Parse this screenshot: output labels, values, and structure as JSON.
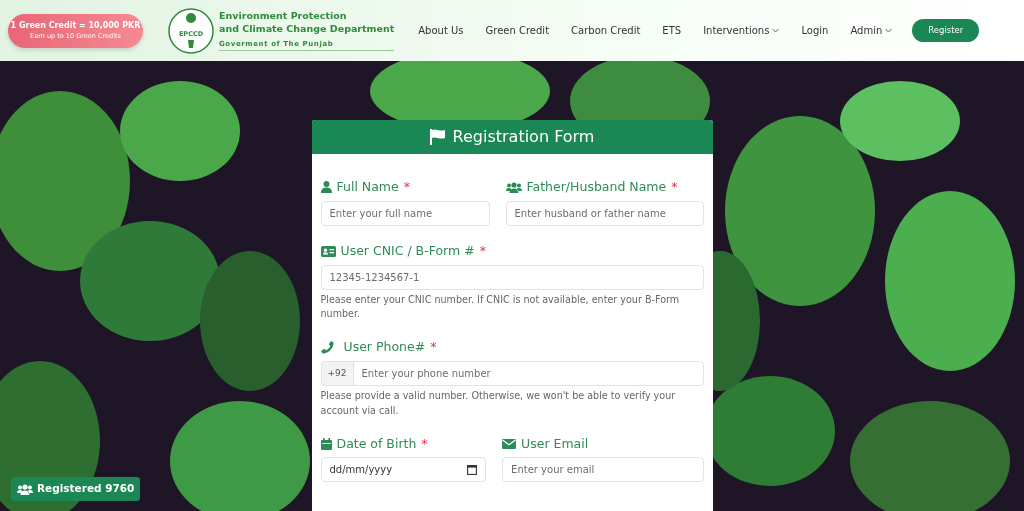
{
  "promo": {
    "title": "1 Green Credit = 10,000 PKR",
    "subtitle": "Earn up to 10 Green Credits"
  },
  "brand": {
    "logo_text": "EPCCD",
    "name_lines": [
      "Environment Protection",
      "and Climate Change Department"
    ],
    "subtitle": "Goverment of The Punjab"
  },
  "nav": {
    "items": [
      {
        "label": "About Us",
        "dropdown": false
      },
      {
        "label": "Green Credit",
        "dropdown": false
      },
      {
        "label": "Carbon Credit",
        "dropdown": false
      },
      {
        "label": "ETS",
        "dropdown": false
      },
      {
        "label": "Interventions",
        "dropdown": true
      },
      {
        "label": "Login",
        "dropdown": false
      },
      {
        "label": "Admin",
        "dropdown": true
      }
    ],
    "button": "Register"
  },
  "form": {
    "title": "Registration Form",
    "rows": [
      [
        {
          "kind": "text",
          "label": "Full Name",
          "required_mark": "*",
          "placeholder": "Enter your full name"
        },
        {
          "kind": "text",
          "label": "Father/Husband Name",
          "required_mark": "*",
          "placeholder": "Enter husband or father name"
        }
      ],
      [
        {
          "kind": "text",
          "label": "User CNIC / B-Form #",
          "required_mark": "*",
          "placeholder": "12345-1234567-1",
          "help": "Please enter your CNIC number. If CNIC is not available, enter your B-Form number."
        }
      ],
      [
        {
          "kind": "phone",
          "label": "User Phone#",
          "required_mark": "*",
          "prefix": "+92",
          "placeholder": "Enter your phone number",
          "help": "Please provide a valid number. Otherwise, we won't be able to verify your account via call."
        }
      ],
      [
        {
          "kind": "date",
          "label": "Date of Birth",
          "required_mark": "*",
          "placeholder": "dd/mm/yyyy"
        },
        {
          "kind": "text",
          "label": "User Email",
          "placeholder": "Enter your email"
        }
      ]
    ]
  },
  "registered_badge": "Registered 9760"
}
